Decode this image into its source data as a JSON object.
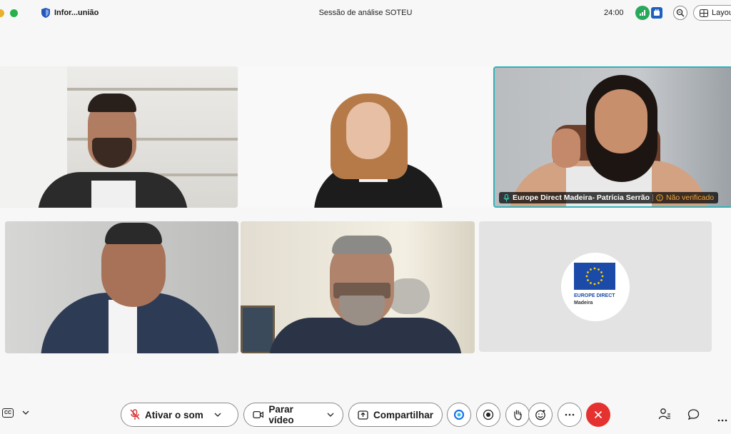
{
  "topbar": {
    "meeting_name": "Infor...união",
    "title": "Sessão de análise SOTEU",
    "timer": "24:00",
    "layout_label": "Layout"
  },
  "tiles": {
    "highlighted": {
      "name": "Europe Direct Madeira- Patrícia Serrão",
      "status": "Não verificado"
    },
    "logo": {
      "line1": "EUROPE DIRECT",
      "line2": "Madeira"
    }
  },
  "controls": {
    "mute_label": "Ativar o som",
    "video_label": "Parar vídeo",
    "share_label": "Compartilhar",
    "cc_label": "CC"
  },
  "colors": {
    "accent_border": "#2fb3b8",
    "end_call": "#e5312f",
    "eu_blue": "#1c4aa8",
    "eu_star": "#ffd400"
  }
}
